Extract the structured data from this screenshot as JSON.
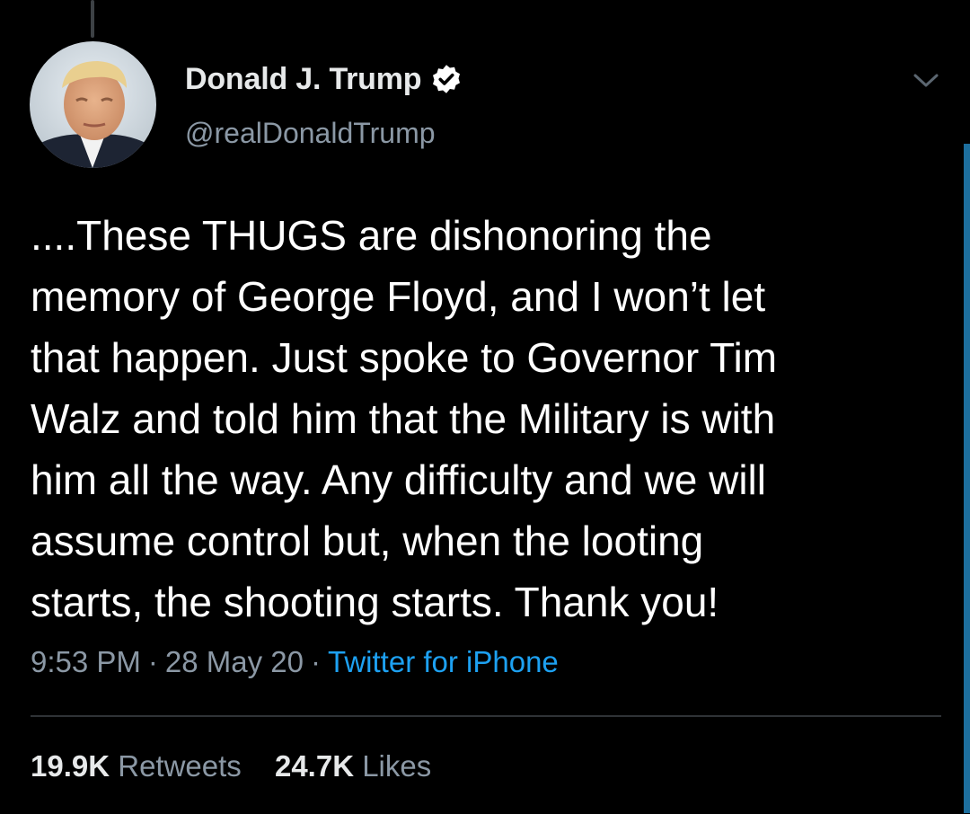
{
  "tweet": {
    "author": {
      "display_name": "Donald J. Trump",
      "handle": "@realDonaldTrump",
      "verified": true,
      "avatar_icon": "profile-photo"
    },
    "text": "....These THUGS are dishonoring the\nmemory of George Floyd, and I won’t let\nthat happen. Just spoke to Governor Tim\nWalz and told him that the Military is with\nhim all the way. Any difficulty and we will\nassume control but, when the looting\nstarts, the shooting starts. Thank you!",
    "time": "9:53 PM",
    "date": "28 May 20",
    "separator": "·",
    "source": "Twitter for iPhone",
    "stats": {
      "retweets_count": "19.9K",
      "retweets_label": "Retweets",
      "likes_count": "24.7K",
      "likes_label": "Likes"
    },
    "menu_icon": "chevron-down-icon"
  },
  "colors": {
    "background": "#000000",
    "primary_text": "#e7e9ea",
    "secondary_text": "#8b98a5",
    "link": "#1da1f2",
    "divider": "#2f3336",
    "scroll_indicator": "#1d6f9e"
  }
}
